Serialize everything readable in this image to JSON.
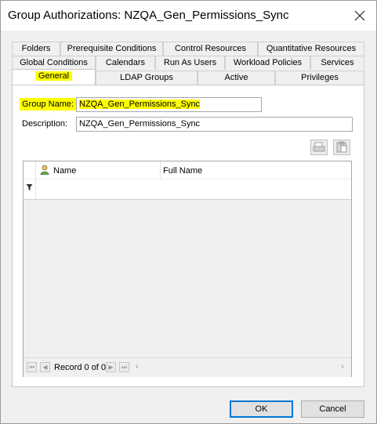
{
  "window": {
    "title": "Group Authorizations: NZQA_Gen_Permissions_Sync",
    "close_icon": "close-icon"
  },
  "tabs": {
    "row1": [
      "Folders",
      "Prerequisite Conditions",
      "Control Resources",
      "Quantitative Resources"
    ],
    "row2": [
      "Global Conditions",
      "Calendars",
      "Run As Users",
      "Workload Policies",
      "Services"
    ],
    "row3": [
      "General",
      "LDAP Groups",
      "Active",
      "Privileges"
    ],
    "active": "General"
  },
  "form": {
    "group_name_label": "Group Name:",
    "group_name_value": "NZQA_Gen_Permissions_Sync",
    "description_label": "Description:",
    "description_value": "NZQA_Gen_Permissions_Sync"
  },
  "grid": {
    "columns": [
      "Name",
      "Full Name"
    ],
    "filter_icon": "filter-icon",
    "record_text": "Record 0 of 0"
  },
  "buttons": {
    "ok": "OK",
    "cancel": "Cancel"
  },
  "colors": {
    "highlight": "#ffff00",
    "primary_border": "#0078d7"
  }
}
